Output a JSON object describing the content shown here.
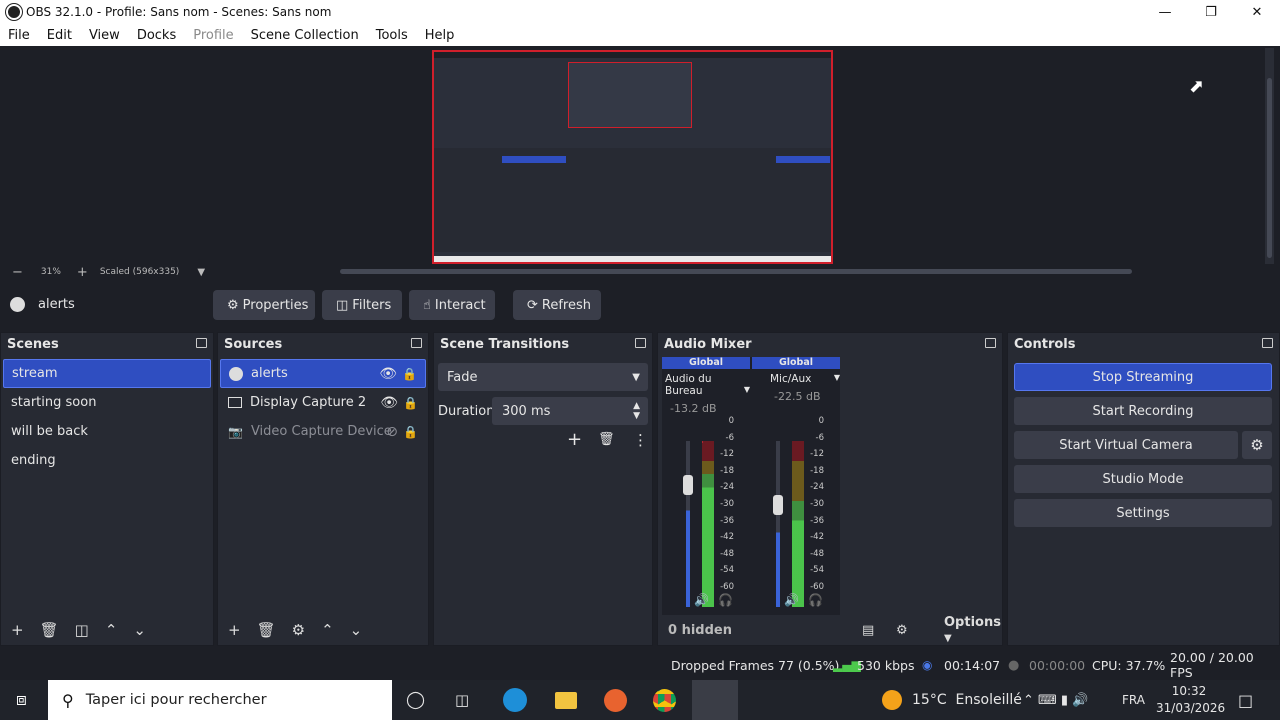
{
  "window": {
    "title": "OBS 32.1.0 - Profile: Sans nom - Scenes: Sans nom"
  },
  "menu": [
    "File",
    "Edit",
    "View",
    "Docks",
    "Profile",
    "Scene Collection",
    "Tools",
    "Help"
  ],
  "zoom": {
    "level": "31%",
    "scale": "Scaled (596x335)"
  },
  "source_toolbar": {
    "source_name": "alerts",
    "properties": "Properties",
    "filters": "Filters",
    "interact": "Interact",
    "refresh": "Refresh"
  },
  "scenes": {
    "title": "Scenes",
    "items": [
      "stream",
      "starting soon",
      "will be back",
      "ending"
    ],
    "selected": "stream"
  },
  "sources": {
    "title": "Sources",
    "items": [
      {
        "label": "alerts",
        "icon": "globe-icon",
        "visible": true
      },
      {
        "label": "Display Capture 2",
        "icon": "monitor-icon",
        "visible": true
      },
      {
        "label": "Video Capture Device",
        "icon": "camera-icon",
        "visible": false
      }
    ]
  },
  "transitions": {
    "title": "Scene Transitions",
    "type": "Fade",
    "duration_label": "Duration",
    "duration": "300 ms"
  },
  "mixer": {
    "title": "Audio Mixer",
    "channels": [
      {
        "group": "Global",
        "name": "Audio du Bureau",
        "db": "-13.2 dB"
      },
      {
        "group": "Global",
        "name": "Mic/Aux",
        "db": "-22.5 dB"
      }
    ],
    "scale": [
      "0",
      "-6",
      "-12",
      "-18",
      "-24",
      "-30",
      "-36",
      "-42",
      "-48",
      "-54",
      "-60"
    ],
    "hidden": "0 hidden",
    "options": "Options"
  },
  "controls": {
    "title": "Controls",
    "buttons": [
      "Stop Streaming",
      "Start Recording",
      "Start Virtual Camera",
      "Studio Mode",
      "Settings"
    ]
  },
  "status": {
    "dropped": "Dropped Frames 77 (0.5%)",
    "kbps": "530 kbps",
    "stream_time": "00:14:07",
    "rec_time": "00:00:00",
    "cpu": "CPU: 37.7%",
    "fps": "20.00 / 20.00 FPS"
  },
  "taskbar": {
    "search_placeholder": "Taper ici pour rechercher",
    "weather": "15°C  Ensoleillé",
    "lang": "FRA",
    "time": "10:32",
    "date": "31/03/2026"
  },
  "colors": {
    "accent": "#2f4ec1",
    "canvas_border": "#d01f2b",
    "meter_green": "#4cc94c",
    "meter_yellow": "#d8c340",
    "meter_red": "#b0262f"
  }
}
